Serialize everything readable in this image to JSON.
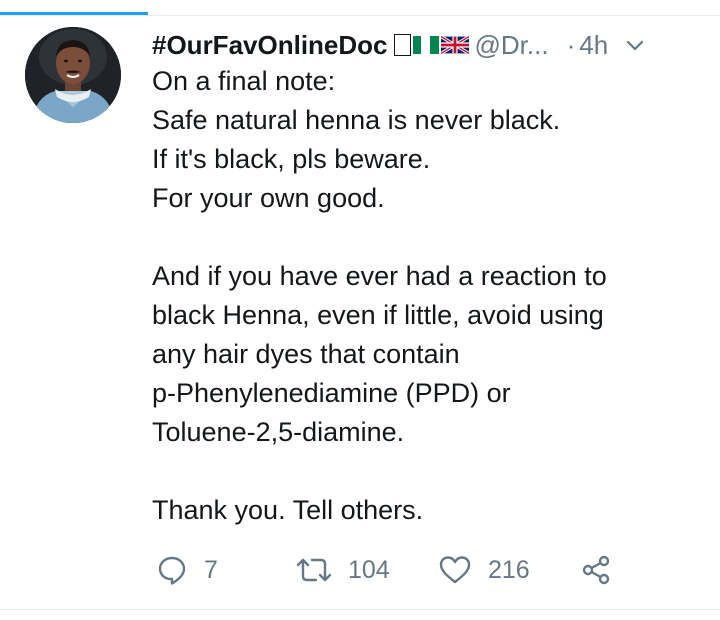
{
  "tweet": {
    "display_name": "#OurFavOnlineDoc",
    "handle": "@Dr...",
    "separator": "·",
    "time": "4h",
    "avatar_icon": "user-avatar-photo",
    "text_lines": [
      "On a final note:",
      "Safe natural henna is never black.",
      "If it's black, pls beware.",
      "For your own good.",
      "",
      "And if you have ever had a reaction to",
      "black Henna, even if little, avoid using",
      "any hair dyes that contain",
      "p-Phenylenediamine (PPD) or",
      "Toluene-2,5-diamine.",
      "",
      "Thank you. Tell others."
    ]
  },
  "actions": {
    "reply_count": "7",
    "retweet_count": "104",
    "like_count": "216"
  },
  "colors": {
    "accent": "#1da1f2",
    "text": "#14171a",
    "secondary": "#657786",
    "divider": "#e6ecf0"
  }
}
